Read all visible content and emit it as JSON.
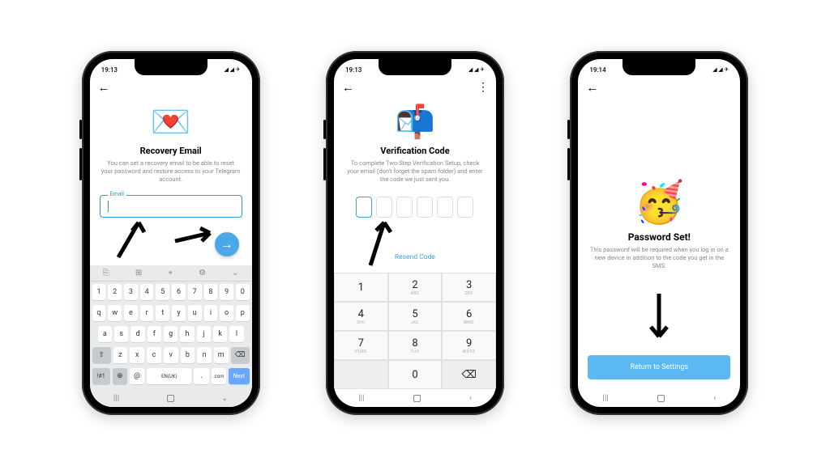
{
  "screen1": {
    "status_time": "19:13",
    "title": "Recovery Email",
    "desc": "You can set a recovery email to be able to reset your password and restore access to your Telegram account.",
    "field_label": "Email",
    "keyboard": {
      "numrow": [
        "1",
        "2",
        "3",
        "4",
        "5",
        "6",
        "7",
        "8",
        "9",
        "0"
      ],
      "row1": [
        "q",
        "w",
        "e",
        "r",
        "t",
        "y",
        "u",
        "i",
        "o",
        "p"
      ],
      "row2": [
        "a",
        "s",
        "d",
        "f",
        "g",
        "h",
        "j",
        "k",
        "l"
      ],
      "row3_shift": "⇧",
      "row3": [
        "z",
        "x",
        "c",
        "v",
        "b",
        "n",
        "m"
      ],
      "row3_del": "⌫",
      "bottom": {
        "sym": "!#1",
        "globe": "⊕",
        "at": "@",
        "lang": "EN(UK)",
        "dot": ".",
        "com": ".com",
        "next": "Next"
      }
    }
  },
  "screen2": {
    "status_time": "19:13",
    "title": "Verification Code",
    "desc": "To complete Two-Step Verification Setup, check your email (don't forget the spam folder) and enter the code we just sent you.",
    "resend": "Resend Code",
    "keypad": [
      {
        "n": "1",
        "l": ""
      },
      {
        "n": "2",
        "l": "ABC"
      },
      {
        "n": "3",
        "l": "DEF"
      },
      {
        "n": "4",
        "l": "GHI"
      },
      {
        "n": "5",
        "l": "JKL"
      },
      {
        "n": "6",
        "l": "MNO"
      },
      {
        "n": "7",
        "l": "PQRS"
      },
      {
        "n": "8",
        "l": "TUV"
      },
      {
        "n": "9",
        "l": "WXYZ"
      },
      {
        "n": "",
        "l": ""
      },
      {
        "n": "0",
        "l": ""
      },
      {
        "n": "⌫",
        "l": ""
      }
    ]
  },
  "screen3": {
    "status_time": "19:14",
    "title": "Password Set!",
    "desc": "This password will be required when you log in on a new device in addition to the code you get in the SMS.",
    "button": "Return to Settings"
  }
}
